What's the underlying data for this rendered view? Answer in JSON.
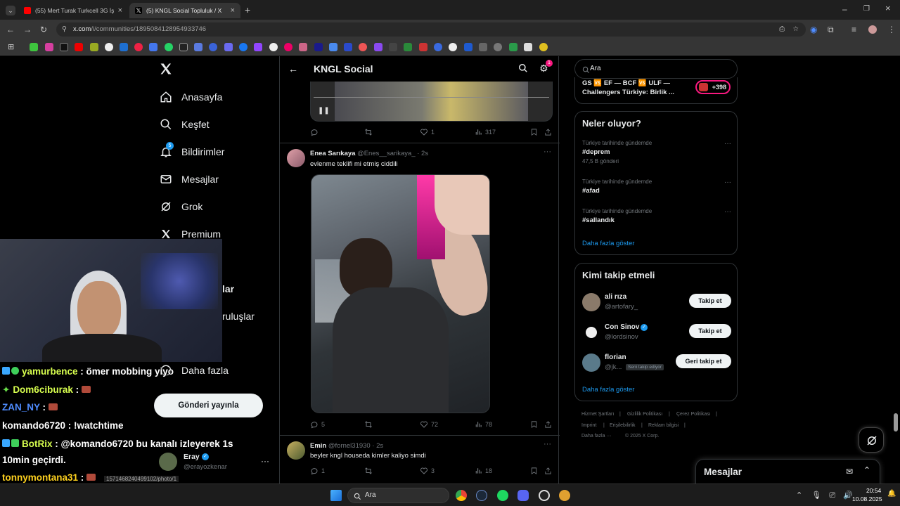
{
  "browser": {
    "tabs": [
      {
        "title": "(55) Mert Turak Turkcell 3G İşte",
        "favicon_color": "#ff0000"
      },
      {
        "title": "(5) KNGL Social Topluluk / X",
        "favicon_color": "#ffffff"
      }
    ],
    "url_host": "x.com",
    "url_path": "/i/communities/1895084128954933746"
  },
  "sidebar": {
    "items": [
      {
        "label": "Anasayfa",
        "icon": "home-icon"
      },
      {
        "label": "Keşfet",
        "icon": "search-icon"
      },
      {
        "label": "Bildirimler",
        "icon": "bell-icon",
        "badge": "5"
      },
      {
        "label": "Mesajlar",
        "icon": "mail-icon"
      },
      {
        "label": "Grok",
        "icon": "grok-icon"
      },
      {
        "label": "Premium",
        "icon": "x-logo-icon"
      },
      {
        "label": "leri"
      },
      {
        "label": "lar"
      },
      {
        "label": "ruluşlar"
      },
      {
        "label": "Daha fazla"
      }
    ],
    "post_button": "Gönderi yayınla",
    "account": {
      "name": "Eray",
      "handle": "@erayozkenar"
    }
  },
  "feed": {
    "title": "KNGL Social",
    "settings_badge": "1",
    "tweets": [
      {
        "replies": "",
        "retweets": "",
        "likes": "1",
        "views": "317"
      },
      {
        "name": "Enea Sarıkaya",
        "handle": "@Enes__sarikaya_",
        "time": "· 2s",
        "text": "evlenme teklifi mi etmiş ciddili",
        "replies": "5",
        "retweets": "",
        "likes": "72",
        "views": "78"
      },
      {
        "name": "Emin",
        "handle": "@fornel31930",
        "time": "· 2s",
        "text": "beyler kngl houseda kimler kaliyo simdi",
        "replies": "1",
        "retweets": "",
        "likes": "3",
        "views": "18"
      }
    ]
  },
  "right": {
    "search_placeholder": "Ara",
    "community": {
      "text1": "GS 🆚 EF — BCF 🆚 ULF —",
      "text2": "Challengers Türkiye: Birlik ...",
      "count": "+398"
    },
    "trends_title": "Neler oluyor?",
    "trends": [
      {
        "sub": "Türkiye tarihinde gündemde",
        "tag": "#deprem",
        "count": "47,5 B gönderi"
      },
      {
        "sub": "Türkiye tarihinde gündemde",
        "tag": "#afad",
        "count": ""
      },
      {
        "sub": "Türkiye tarihinde gündemde",
        "tag": "#sallandık",
        "count": ""
      }
    ],
    "trends_more": "Daha fazla göster",
    "who_title": "Kimi takip etmeli",
    "who": [
      {
        "name": "ali rıza",
        "handle": "@artofary_",
        "button": "Takip et",
        "verified": false
      },
      {
        "name": "Con Sinov",
        "handle": "@lordsinov",
        "button": "Takip et",
        "verified": true
      },
      {
        "name": "florian",
        "handle": "@jk...",
        "button": "Geri takip et",
        "badge": "Seni takip ediyor"
      }
    ],
    "who_more": "Daha fazla göster",
    "footer": [
      "Hizmet Şartları",
      "Gizlilik Politikası",
      "Çerez Politikası",
      "Imprint",
      "Erişilebilirlik",
      "Reklam bilgisi",
      "Daha fazla ···",
      "© 2025 X Corp."
    ],
    "messages_title": "Mesajlar"
  },
  "chat": [
    {
      "user": "yamurbence",
      "msg": " : ömer mobbing yiyo",
      "color": "#d8ff4f"
    },
    {
      "user": "Dom6ciburak",
      "msg": " : ",
      "color": "#d8ff4f"
    },
    {
      "user": "ZAN_NY",
      "msg": " : ",
      "color": "#4f8cff"
    },
    {
      "user": "komando6720",
      "msg": " : !watchtime",
      "color": "#ffffff"
    },
    {
      "user": "BotRix",
      "msg": " : @komando6720 bu kanalı izleyerek 1s",
      "color": "#d8ff4f"
    },
    {
      "user": "",
      "msg": "10min geçirdi.",
      "color": "#ffffff"
    },
    {
      "user": "tonnymontana31",
      "msg": " : ",
      "color": "#ffd21f"
    }
  ],
  "chat_link": "1571468240499102/photo/1",
  "taskbar": {
    "search": "Ara",
    "time": "20:54",
    "date": "10.08.2025"
  }
}
